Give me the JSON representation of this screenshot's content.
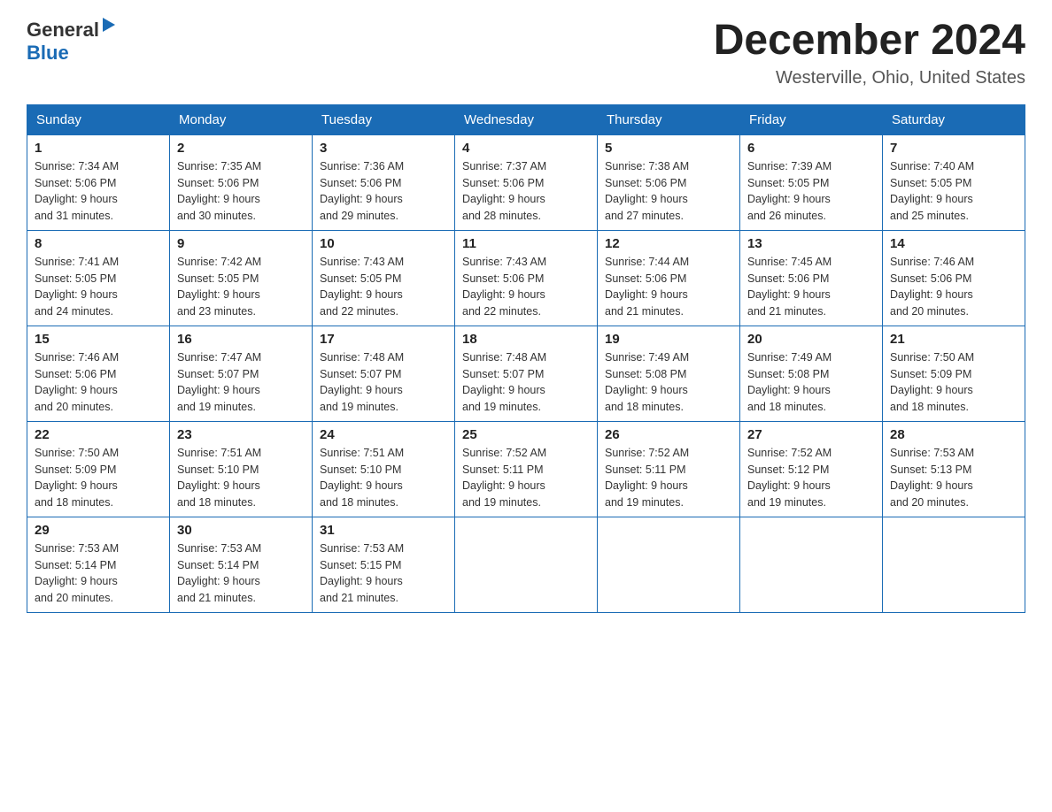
{
  "logo": {
    "general": "General",
    "blue": "Blue"
  },
  "title": "December 2024",
  "subtitle": "Westerville, Ohio, United States",
  "days_of_week": [
    "Sunday",
    "Monday",
    "Tuesday",
    "Wednesday",
    "Thursday",
    "Friday",
    "Saturday"
  ],
  "weeks": [
    [
      {
        "day": "1",
        "sunrise": "7:34 AM",
        "sunset": "5:06 PM",
        "daylight": "9 hours and 31 minutes."
      },
      {
        "day": "2",
        "sunrise": "7:35 AM",
        "sunset": "5:06 PM",
        "daylight": "9 hours and 30 minutes."
      },
      {
        "day": "3",
        "sunrise": "7:36 AM",
        "sunset": "5:06 PM",
        "daylight": "9 hours and 29 minutes."
      },
      {
        "day": "4",
        "sunrise": "7:37 AM",
        "sunset": "5:06 PM",
        "daylight": "9 hours and 28 minutes."
      },
      {
        "day": "5",
        "sunrise": "7:38 AM",
        "sunset": "5:06 PM",
        "daylight": "9 hours and 27 minutes."
      },
      {
        "day": "6",
        "sunrise": "7:39 AM",
        "sunset": "5:05 PM",
        "daylight": "9 hours and 26 minutes."
      },
      {
        "day": "7",
        "sunrise": "7:40 AM",
        "sunset": "5:05 PM",
        "daylight": "9 hours and 25 minutes."
      }
    ],
    [
      {
        "day": "8",
        "sunrise": "7:41 AM",
        "sunset": "5:05 PM",
        "daylight": "9 hours and 24 minutes."
      },
      {
        "day": "9",
        "sunrise": "7:42 AM",
        "sunset": "5:05 PM",
        "daylight": "9 hours and 23 minutes."
      },
      {
        "day": "10",
        "sunrise": "7:43 AM",
        "sunset": "5:05 PM",
        "daylight": "9 hours and 22 minutes."
      },
      {
        "day": "11",
        "sunrise": "7:43 AM",
        "sunset": "5:06 PM",
        "daylight": "9 hours and 22 minutes."
      },
      {
        "day": "12",
        "sunrise": "7:44 AM",
        "sunset": "5:06 PM",
        "daylight": "9 hours and 21 minutes."
      },
      {
        "day": "13",
        "sunrise": "7:45 AM",
        "sunset": "5:06 PM",
        "daylight": "9 hours and 21 minutes."
      },
      {
        "day": "14",
        "sunrise": "7:46 AM",
        "sunset": "5:06 PM",
        "daylight": "9 hours and 20 minutes."
      }
    ],
    [
      {
        "day": "15",
        "sunrise": "7:46 AM",
        "sunset": "5:06 PM",
        "daylight": "9 hours and 20 minutes."
      },
      {
        "day": "16",
        "sunrise": "7:47 AM",
        "sunset": "5:07 PM",
        "daylight": "9 hours and 19 minutes."
      },
      {
        "day": "17",
        "sunrise": "7:48 AM",
        "sunset": "5:07 PM",
        "daylight": "9 hours and 19 minutes."
      },
      {
        "day": "18",
        "sunrise": "7:48 AM",
        "sunset": "5:07 PM",
        "daylight": "9 hours and 19 minutes."
      },
      {
        "day": "19",
        "sunrise": "7:49 AM",
        "sunset": "5:08 PM",
        "daylight": "9 hours and 18 minutes."
      },
      {
        "day": "20",
        "sunrise": "7:49 AM",
        "sunset": "5:08 PM",
        "daylight": "9 hours and 18 minutes."
      },
      {
        "day": "21",
        "sunrise": "7:50 AM",
        "sunset": "5:09 PM",
        "daylight": "9 hours and 18 minutes."
      }
    ],
    [
      {
        "day": "22",
        "sunrise": "7:50 AM",
        "sunset": "5:09 PM",
        "daylight": "9 hours and 18 minutes."
      },
      {
        "day": "23",
        "sunrise": "7:51 AM",
        "sunset": "5:10 PM",
        "daylight": "9 hours and 18 minutes."
      },
      {
        "day": "24",
        "sunrise": "7:51 AM",
        "sunset": "5:10 PM",
        "daylight": "9 hours and 18 minutes."
      },
      {
        "day": "25",
        "sunrise": "7:52 AM",
        "sunset": "5:11 PM",
        "daylight": "9 hours and 19 minutes."
      },
      {
        "day": "26",
        "sunrise": "7:52 AM",
        "sunset": "5:11 PM",
        "daylight": "9 hours and 19 minutes."
      },
      {
        "day": "27",
        "sunrise": "7:52 AM",
        "sunset": "5:12 PM",
        "daylight": "9 hours and 19 minutes."
      },
      {
        "day": "28",
        "sunrise": "7:53 AM",
        "sunset": "5:13 PM",
        "daylight": "9 hours and 20 minutes."
      }
    ],
    [
      {
        "day": "29",
        "sunrise": "7:53 AM",
        "sunset": "5:14 PM",
        "daylight": "9 hours and 20 minutes."
      },
      {
        "day": "30",
        "sunrise": "7:53 AM",
        "sunset": "5:14 PM",
        "daylight": "9 hours and 21 minutes."
      },
      {
        "day": "31",
        "sunrise": "7:53 AM",
        "sunset": "5:15 PM",
        "daylight": "9 hours and 21 minutes."
      },
      null,
      null,
      null,
      null
    ]
  ],
  "labels": {
    "sunrise": "Sunrise:",
    "sunset": "Sunset:",
    "daylight": "Daylight:"
  }
}
